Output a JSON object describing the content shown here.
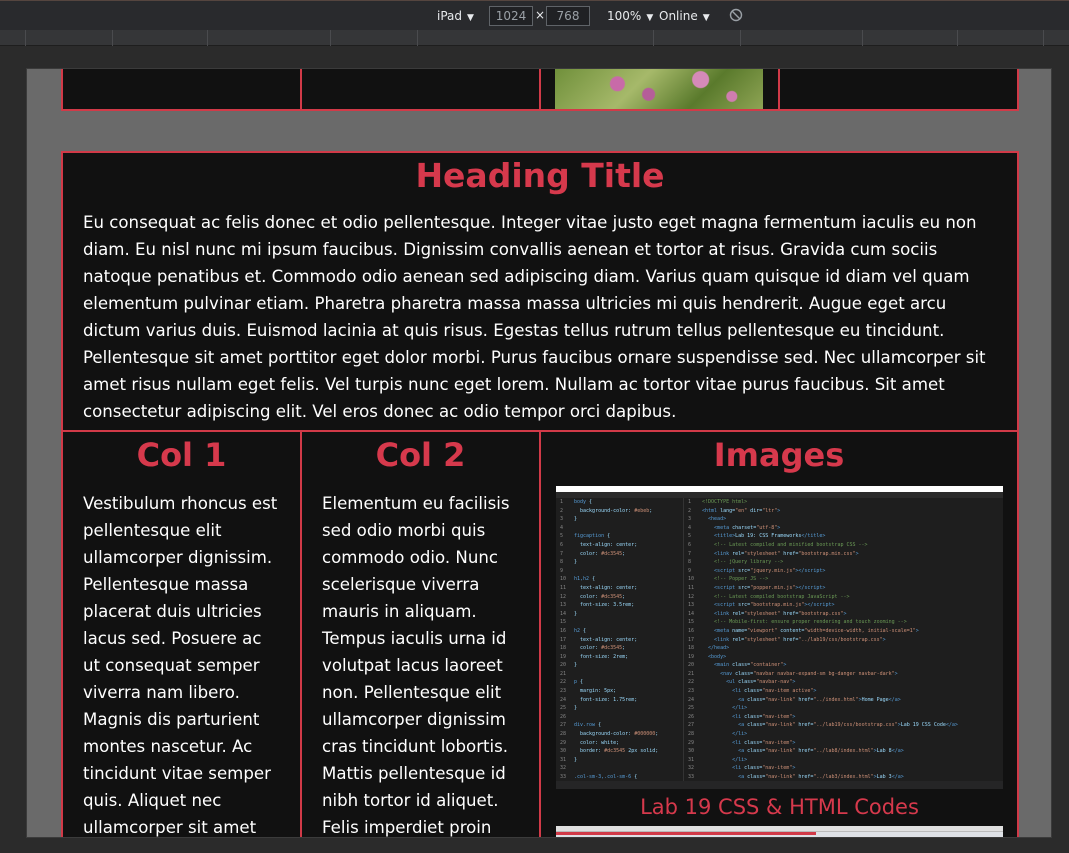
{
  "toolbar": {
    "device": "iPad",
    "width": "1024",
    "times": "×",
    "height": "768",
    "zoom": "100%",
    "network": "Online",
    "caret": "▼"
  },
  "page": {
    "heading": "Heading Title",
    "intro": "Eu consequat ac felis donec et odio pellentesque. Integer vitae justo eget magna fermentum iaculis eu non diam. Eu nisl nunc mi ipsum faucibus. Dignissim convallis aenean et tortor at risus. Gravida cum sociis natoque penatibus et. Commodo odio aenean sed adipiscing diam. Varius quam quisque id diam vel quam elementum pulvinar etiam. Pharetra pharetra massa massa ultricies mi quis hendrerit. Augue eget arcu dictum varius duis. Euismod lacinia at quis risus. Egestas tellus rutrum tellus pellentesque eu tincidunt. Pellentesque sit amet porttitor eget dolor morbi. Purus faucibus ornare suspendisse sed. Nec ullamcorper sit amet risus nullam eget felis. Vel turpis nunc eget lorem. Nullam ac tortor vitae purus faucibus. Sit amet consectetur adipiscing elit. Vel eros donec ac odio tempor orci dapibus.",
    "col1": {
      "title": "Col 1",
      "text": "Vestibulum rhoncus est pellentesque elit ullamcorper dignissim. Pellentesque massa placerat duis ultricies lacus sed. Posuere ac ut consequat semper viverra nam libero. Magnis dis parturient montes nascetur. Ac tincidunt vitae semper quis. Aliquet nec ullamcorper sit amet"
    },
    "col2": {
      "title": "Col 2",
      "text": "Elementum eu facilisis sed odio morbi quis commodo odio. Nunc scelerisque viverra mauris in aliquam. Tempus iaculis urna id volutpat lacus laoreet non. Pellentesque elit ullamcorper dignissim cras tincidunt lobortis. Mattis pellentesque id nibh tortor id aliquet. Felis imperdiet proin"
    },
    "images": {
      "title": "Images",
      "caption": "Lab 19 CSS & HTML Codes"
    }
  },
  "colors": {
    "accent": "#d13a48",
    "heading": "#d6394c",
    "panel": "#111111"
  }
}
